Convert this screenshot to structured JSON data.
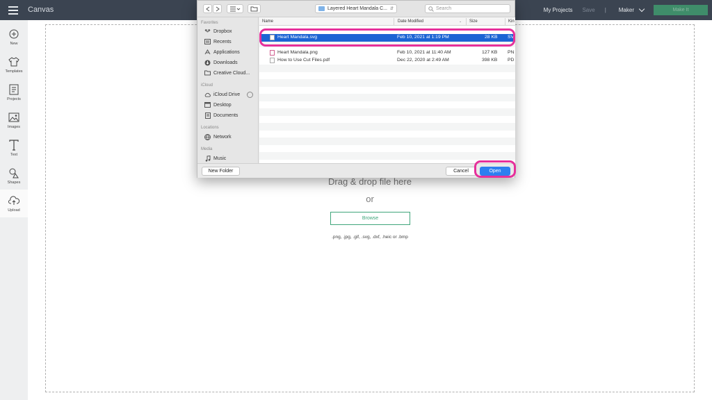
{
  "app": {
    "title": "Canvas"
  },
  "header": {
    "my_projects": "My Projects",
    "save": "Save",
    "divider": "|",
    "machine": "Maker",
    "make_it": "Make It"
  },
  "sidebar": {
    "items": [
      {
        "label": "New",
        "icon": "plus-circle-icon"
      },
      {
        "label": "Templates",
        "icon": "tshirt-icon"
      },
      {
        "label": "Projects",
        "icon": "projects-icon"
      },
      {
        "label": "Images",
        "icon": "image-icon"
      },
      {
        "label": "Text",
        "icon": "text-icon"
      },
      {
        "label": "Shapes",
        "icon": "shapes-icon"
      },
      {
        "label": "Upload",
        "icon": "cloud-upload-icon"
      }
    ]
  },
  "upload": {
    "drag_text": "Drag & drop file here",
    "or_text": "or",
    "browse": "Browse",
    "formats": ".png, .jpg, .gif, .svg, .dxf, .heic or .bmp"
  },
  "dialog": {
    "location": "Layered Heart Mandala C...",
    "search_placeholder": "Search",
    "favorites_head": "Favorites",
    "favorites": [
      "Dropbox",
      "Recents",
      "Applications",
      "Downloads",
      "Creative Cloud..."
    ],
    "icloud_head": "iCloud",
    "icloud": [
      "iCloud Drive",
      "Desktop",
      "Documents"
    ],
    "locations_head": "Locations",
    "locations": [
      "Network"
    ],
    "media_head": "Media",
    "media": [
      "Music"
    ],
    "columns": {
      "name": "Name",
      "date": "Date Modified",
      "size": "Size",
      "kind": "Kin"
    },
    "files": [
      {
        "name": "Heart Mandala.svg",
        "date": "Feb 10, 2021 at 1:19 PM",
        "size": "28 KB",
        "kind": "SV"
      },
      {
        "name": "Heart Mandala.png",
        "date": "Feb 10, 2021 at 11:40 AM",
        "size": "127 KB",
        "kind": "PN"
      },
      {
        "name": "How to Use Cut Files.pdf",
        "date": "Dec 22, 2020 at 2:49 AM",
        "size": "398 KB",
        "kind": "PD"
      }
    ],
    "new_folder": "New Folder",
    "cancel": "Cancel",
    "open": "Open"
  },
  "colors": {
    "topbar": "#3b4451",
    "selection": "#1c64d4",
    "highlight": "#e6309b",
    "browse": "#3fa57a"
  }
}
